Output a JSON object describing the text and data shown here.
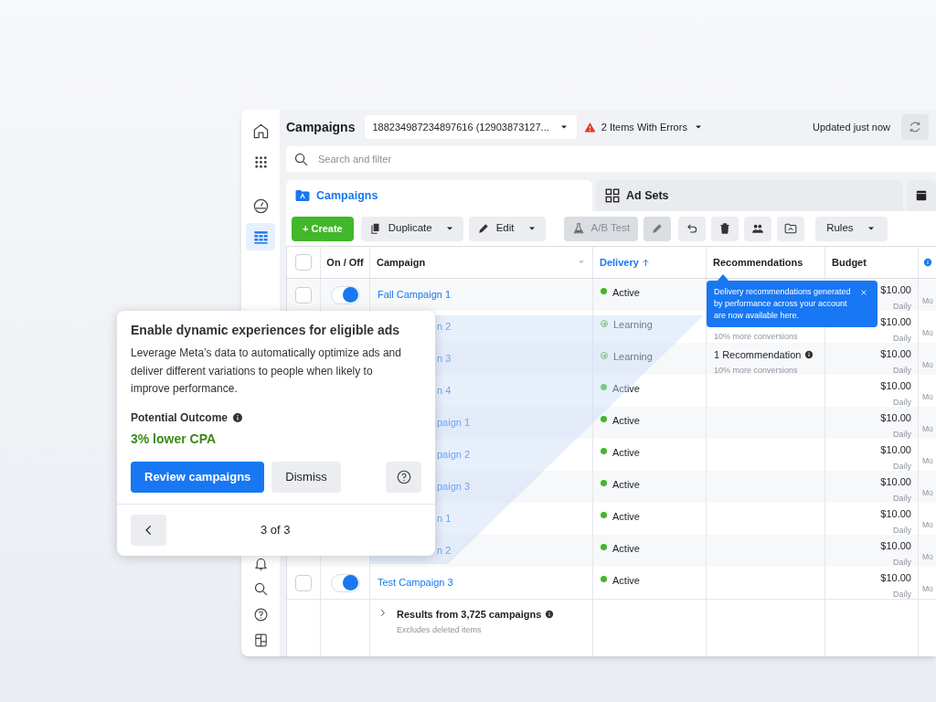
{
  "sidebar": {
    "top_items": [
      {
        "kind": "home",
        "selected": false
      },
      {
        "kind": "apps",
        "selected": false
      },
      {
        "kind": "gauge",
        "selected": false
      },
      {
        "kind": "table",
        "selected": true
      }
    ],
    "bottom_items": [
      {
        "kind": "bell"
      },
      {
        "kind": "search"
      },
      {
        "kind": "help"
      },
      {
        "kind": "panel"
      }
    ]
  },
  "header": {
    "title": "Campaigns",
    "account": "188234987234897616 (12903873127...",
    "errors": "2 Items With Errors",
    "updated": "Updated just now"
  },
  "search": {
    "placeholder": "Search and filter"
  },
  "tabs": [
    {
      "label": "Campaigns",
      "kind": "folder",
      "selected": true
    },
    {
      "label": "Ad Sets",
      "kind": "grid",
      "selected": false
    },
    {
      "kind": "ad",
      "selected": false
    }
  ],
  "toolbar": [
    {
      "kind": "create",
      "label": "+ Create"
    },
    {
      "kind": "menu",
      "label": "Duplicate"
    },
    {
      "kind": "menu",
      "label": "Edit"
    },
    {
      "kind": "text",
      "label": "A/B Test",
      "disabled": true
    },
    {
      "kind": "icon",
      "disabled": true
    },
    {
      "kind": "icon",
      "disabled": false
    },
    {
      "kind": "icon",
      "disabled": false
    },
    {
      "kind": "icon",
      "disabled": false
    },
    {
      "kind": "icon",
      "disabled": false
    },
    {
      "kind": "menu",
      "label": "Rules"
    }
  ],
  "table": {
    "select_all_checked": false,
    "columns": [
      {
        "label": "On / Off",
        "sorted": false
      },
      {
        "label": "Campaign",
        "sorted": false
      },
      {
        "label": "Delivery",
        "sorted": true
      },
      {
        "label": "Recommendations",
        "sorted": false
      },
      {
        "label": "Budget",
        "sorted": false
      }
    ],
    "rows": [
      {
        "checked": false,
        "on": true,
        "name": "Fall Campaign 1",
        "name_cut": false,
        "delivery": "Active",
        "kind": "active",
        "budget": "$10.00",
        "budget_period": "Daily",
        "column_7": "Mo"
      },
      {
        "name": "n 2",
        "name_cut": true,
        "delivery": "Learning",
        "kind": "learning",
        "recommendation_note": "10% more conversions",
        "budget": "$10.00",
        "budget_period": "Daily",
        "column_7": "Mo"
      },
      {
        "name": "n 3",
        "name_cut": true,
        "delivery": "Learning",
        "kind": "learning",
        "recommendation": "1 Recommendation",
        "recommendation_note": "10% more conversions",
        "budget": "$10.00",
        "budget_period": "Daily",
        "column_7": "Mo"
      },
      {
        "name": "n 4",
        "name_cut": true,
        "delivery": "Active",
        "kind": "active",
        "budget": "$10.00",
        "budget_period": "Daily",
        "column_7": "Mo"
      },
      {
        "name": "paign 1",
        "name_cut": true,
        "delivery": "Active",
        "kind": "active",
        "budget": "$10.00",
        "budget_period": "Daily",
        "column_7": "Mo"
      },
      {
        "name": "paign 2",
        "name_cut": true,
        "delivery": "Active",
        "kind": "active",
        "budget": "$10.00",
        "budget_period": "Daily",
        "column_7": "Mo"
      },
      {
        "name": "paign 3",
        "name_cut": true,
        "delivery": "Active",
        "kind": "active",
        "budget": "$10.00",
        "budget_period": "Daily",
        "column_7": "Mo"
      },
      {
        "name": "n 1",
        "name_cut": true,
        "delivery": "Active",
        "kind": "active",
        "budget": "$10.00",
        "budget_period": "Daily",
        "column_7": "Mo"
      },
      {
        "name": "n 2",
        "name_cut": true,
        "delivery": "Active",
        "kind": "active",
        "budget": "$10.00",
        "budget_period": "Daily",
        "column_7": "Mo"
      },
      {
        "checked": false,
        "on": true,
        "name": "Test Campaign 3",
        "name_cut": false,
        "delivery": "Active",
        "kind": "active",
        "budget": "$10.00",
        "budget_period": "Daily",
        "column_7": "Mo"
      }
    ],
    "footer": {
      "title": "Results from 3,725 campaigns",
      "note": "Excludes deleted items"
    }
  },
  "tooltip": {
    "text": "Delivery recommendations generated by performance across your account are now available here."
  },
  "popup": {
    "title": "Enable dynamic experiences for eligible ads",
    "body": "Leverage Meta’s data to automatically optimize ads and deliver different variations to people when likely to improve performance.",
    "outcome_label": "Potential Outcome",
    "outcome_value": "3% lower CPA",
    "primary": "Review campaigns",
    "secondary": "Dismiss",
    "pager": "3 of 3"
  }
}
